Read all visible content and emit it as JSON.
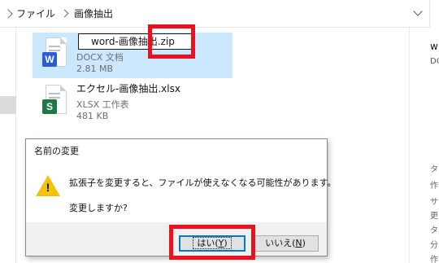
{
  "address_bar": {
    "crumbs": [
      "ファイル",
      "画像抽出"
    ]
  },
  "files": [
    {
      "rename_value": "word-画像抽出.zip",
      "type": "DOCX 文档",
      "size": "2.81 MB",
      "badge": "W"
    },
    {
      "name": "エクセル-画像抽出.xlsx",
      "type": "XLSX 工作表",
      "size": "481 KB",
      "badge": "S"
    }
  ],
  "details_pane": {
    "title": "w",
    "subtitle": "DOCX",
    "labels": [
      "タ",
      "作",
      "サ",
      "更",
      "タ",
      "分",
      "作"
    ]
  },
  "dialog": {
    "title": "名前の変更",
    "message": "拡張子を変更すると、ファイルが使えなくなる可能性があります。",
    "question": "変更しますか?",
    "yes_label": "はい",
    "yes_key": "Y",
    "no_label": "いいえ",
    "no_key": "N"
  },
  "colors": {
    "highlight": "#e8131f",
    "selection": "#cce8ff",
    "word_badge": "#2b5cd6",
    "excel_badge": "#1d7a45",
    "warning": "#f4c20d"
  }
}
